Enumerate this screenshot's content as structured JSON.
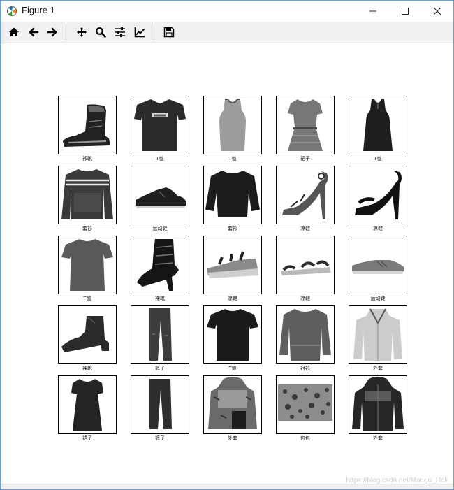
{
  "window": {
    "title": "Figure 1"
  },
  "toolbar": {
    "buttons": [
      {
        "icon": "home-icon",
        "tooltip": "Reset original view"
      },
      {
        "icon": "arrow-left-icon",
        "tooltip": "Back"
      },
      {
        "icon": "arrow-right-icon",
        "tooltip": "Forward"
      },
      {
        "icon": "pan-icon",
        "tooltip": "Pan"
      },
      {
        "icon": "zoom-icon",
        "tooltip": "Zoom"
      },
      {
        "icon": "sliders-icon",
        "tooltip": "Configure subplots"
      },
      {
        "icon": "line-chart-icon",
        "tooltip": "Edit axis"
      },
      {
        "icon": "save-icon",
        "tooltip": "Save"
      }
    ]
  },
  "figure": {
    "images": [
      {
        "label": "裸靴",
        "item": "ankle-boot"
      },
      {
        "label": "T恤",
        "item": "tshirt"
      },
      {
        "label": "T恤",
        "item": "tanktop"
      },
      {
        "label": "裙子",
        "item": "dress"
      },
      {
        "label": "T恤",
        "item": "tanktop-dark"
      },
      {
        "label": "套衫",
        "item": "sweater-striped"
      },
      {
        "label": "运动鞋",
        "item": "sneaker"
      },
      {
        "label": "套衫",
        "item": "sweater"
      },
      {
        "label": "凉鞋",
        "item": "sandal-heel"
      },
      {
        "label": "凉鞋",
        "item": "sandal-heel-dark"
      },
      {
        "label": "T恤",
        "item": "tshirt-gray"
      },
      {
        "label": "裸靴",
        "item": "boot-tall"
      },
      {
        "label": "凉鞋",
        "item": "sandal-wedge"
      },
      {
        "label": "凉鞋",
        "item": "sandal-flat"
      },
      {
        "label": "运动鞋",
        "item": "sneaker-low"
      },
      {
        "label": "裸靴",
        "item": "ankle-boot-2"
      },
      {
        "label": "裤子",
        "item": "trousers"
      },
      {
        "label": "T恤",
        "item": "tshirt-dark"
      },
      {
        "label": "衬衫",
        "item": "shirt"
      },
      {
        "label": "外套",
        "item": "coat-light"
      },
      {
        "label": "裙子",
        "item": "dress-dark"
      },
      {
        "label": "裤子",
        "item": "trousers-2"
      },
      {
        "label": "外套",
        "item": "jacket-pattern"
      },
      {
        "label": "包包",
        "item": "bag"
      },
      {
        "label": "外套",
        "item": "coat-dark"
      }
    ]
  },
  "watermark": "https://blog.csdn.net/Mango_Holi",
  "colors": {
    "window_border": "#6f9fd6",
    "toolbar_bg": "#f0f0f0"
  }
}
